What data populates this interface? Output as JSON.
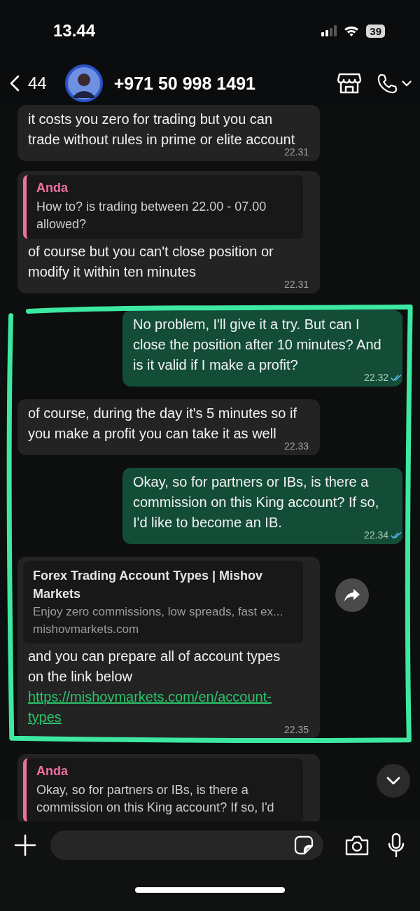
{
  "status_bar": {
    "time": "13.44",
    "battery": "39"
  },
  "header": {
    "back_count": "44",
    "title": "+971 50 998 1491"
  },
  "messages": [
    {
      "kind": "incoming",
      "highlighted": false,
      "text": "it costs you zero for trading but you can trade without rules in prime or elite account",
      "time": "22.31"
    },
    {
      "kind": "incoming",
      "highlighted": false,
      "quote": {
        "author": "Anda",
        "text": "How to? is trading between 22.00 - 07.00 allowed?"
      },
      "text": "of course but you can't close position or modify it within ten minutes",
      "time": "22.31"
    },
    {
      "kind": "outgoing",
      "highlighted": true,
      "text": "No problem, I'll give it a try. But can I close the position after 10 minutes? And is it valid if I make a profit?",
      "time": "22.32",
      "read": true
    },
    {
      "kind": "incoming",
      "highlighted": true,
      "text": "of course, during the day it's 5 minutes so if you make a profit you can take it as well",
      "time": "22.33"
    },
    {
      "kind": "outgoing",
      "highlighted": true,
      "text": "Okay, so for partners or IBs, is there a commission on this King account? If so, I'd like to become an IB.",
      "time": "22.34",
      "read": true
    },
    {
      "kind": "incoming",
      "highlighted": true,
      "forward": true,
      "link_preview": {
        "title": "Forex Trading Account Types | Mishov Markets",
        "description": "Enjoy zero commissions, low spreads, fast ex...",
        "domain": "mishovmarkets.com"
      },
      "text": "and you can prepare all of account types on the link below",
      "link": "https://mishovmarkets.com/en/account-types",
      "time": "22.35"
    },
    {
      "kind": "incoming",
      "highlighted": false,
      "quote": {
        "author": "Anda",
        "text": "Okay, so for partners or IBs, is there a commission on this King account? If so, I'd"
      }
    }
  ]
}
